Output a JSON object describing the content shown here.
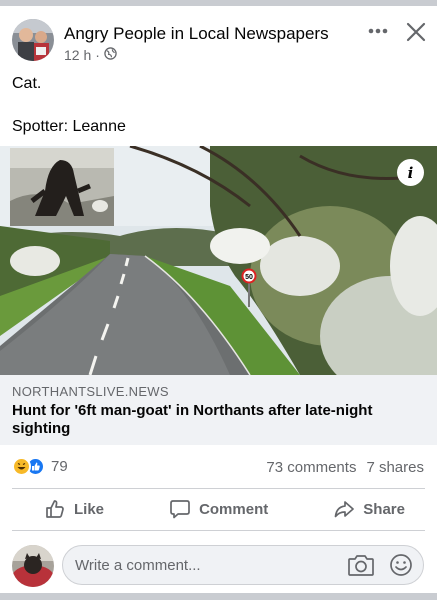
{
  "post": {
    "page_name": "Angry People in Local Newspapers",
    "time": "12 h",
    "separator": "·",
    "audience_icon": "globe-icon",
    "text_line1": "Cat.",
    "text_line2": "Spotter: Leanne"
  },
  "link": {
    "domain": "NORTHANTSLIVE.NEWS",
    "title": "Hunt for '6ft man-goat' in Northants after late-night sighting",
    "info_icon": "i",
    "speed_sign": "50"
  },
  "engagement": {
    "reaction_count": "79",
    "comments": "73 comments",
    "shares": "7 shares"
  },
  "actions": {
    "like": "Like",
    "comment": "Comment",
    "share": "Share"
  },
  "composer": {
    "placeholder": "Write a comment..."
  },
  "colors": {
    "secondary_text": "#65676b",
    "link_box_bg": "#f0f2f5",
    "like_blue": "#1877f2",
    "haha_yellow": "#f7b928"
  }
}
